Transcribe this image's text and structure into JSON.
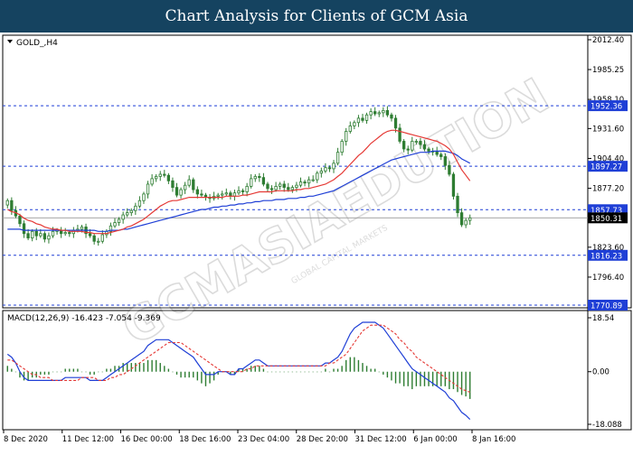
{
  "header": {
    "title": "Chart Analysis for Clients of GCM Asia"
  },
  "watermark": {
    "text": "GCMASIAEDUTION",
    "subtext": "GLOBAL CAPITAL MARKETS"
  },
  "colors": {
    "header_bg": "#154360",
    "candle": "#2e7d32",
    "ma_fast": "#e53935",
    "ma_slow": "#1f3fd6",
    "level_line": "#1f3fd6",
    "price_tag_bg": "#1f3fd6",
    "current_tag_bg": "#000000",
    "macd_hist": "#2e7d32",
    "macd_line": "#1f3fd6",
    "signal_line": "#e53935"
  },
  "chart_data": [
    {
      "type": "candlestick",
      "symbol_label": "GOLD_,H4",
      "ylim": [
        1770.89,
        2012.4
      ],
      "y_ticks": [
        "2012.40",
        "1985.25",
        "1958.10",
        "1931.60",
        "1904.40",
        "1877.20",
        "1850.75",
        "1823.60",
        "1796.40"
      ],
      "x_ticks": [
        "8 Dec 2020",
        "11 Dec 12:00",
        "16 Dec 00:00",
        "18 Dec 16:00",
        "23 Dec 04:00",
        "28 Dec 20:00",
        "31 Dec 12:00",
        "6 Jan 00:00",
        "8 Jan 16:00"
      ],
      "levels": [
        {
          "label": "1952.36",
          "value": 1952.36
        },
        {
          "label": "1897.27",
          "value": 1897.27
        },
        {
          "label": "1857.73",
          "value": 1857.73
        },
        {
          "label": "1816.23",
          "value": 1816.23
        },
        {
          "label": "1770.89",
          "value": 1770.89
        }
      ],
      "current_price": {
        "label": "1850.31",
        "value": 1850.31
      },
      "closes": [
        1866,
        1857,
        1852,
        1845,
        1836,
        1832,
        1838,
        1834,
        1836,
        1831,
        1834,
        1838,
        1839,
        1836,
        1837,
        1836,
        1839,
        1840,
        1842,
        1836,
        1834,
        1829,
        1829,
        1835,
        1838,
        1843,
        1846,
        1849,
        1853,
        1855,
        1857,
        1861,
        1866,
        1872,
        1881,
        1886,
        1888,
        1890,
        1889,
        1884,
        1878,
        1871,
        1876,
        1880,
        1885,
        1876,
        1872,
        1871,
        1869,
        1868,
        1870,
        1871,
        1872,
        1873,
        1870,
        1873,
        1875,
        1874,
        1879,
        1886,
        1888,
        1887,
        1881,
        1877,
        1876,
        1879,
        1881,
        1878,
        1876,
        1878,
        1880,
        1883,
        1882,
        1885,
        1885,
        1891,
        1893,
        1896,
        1895,
        1900,
        1910,
        1920,
        1929,
        1934,
        1937,
        1941,
        1939,
        1944,
        1947,
        1945,
        1946,
        1948,
        1944,
        1941,
        1932,
        1920,
        1913,
        1912,
        1920,
        1920,
        1917,
        1913,
        1911,
        1911,
        1908,
        1906,
        1898,
        1890,
        1870,
        1855,
        1844,
        1848,
        1850.31
      ],
      "ma_fast": {
        "period_label": "",
        "values": [
          1858,
          1856,
          1855,
          1853,
          1850,
          1848,
          1847,
          1845,
          1844,
          1842,
          1841,
          1840,
          1840,
          1839,
          1839,
          1838,
          1838,
          1838,
          1838,
          1837,
          1837,
          1836,
          1836,
          1836,
          1836,
          1837,
          1838,
          1839,
          1840,
          1842,
          1843,
          1845,
          1847,
          1849,
          1852,
          1855,
          1858,
          1861,
          1863,
          1865,
          1866,
          1866,
          1867,
          1868,
          1869,
          1869,
          1869,
          1869,
          1869,
          1869,
          1869,
          1869,
          1869,
          1870,
          1870,
          1870,
          1870,
          1871,
          1871,
          1872,
          1873,
          1874,
          1874,
          1874,
          1874,
          1875,
          1875,
          1875,
          1875,
          1875,
          1876,
          1876,
          1877,
          1877,
          1878,
          1879,
          1880,
          1881,
          1883,
          1885,
          1888,
          1891,
          1895,
          1899,
          1903,
          1907,
          1910,
          1914,
          1918,
          1921,
          1924,
          1927,
          1929,
          1930,
          1930,
          1929,
          1928,
          1927,
          1926,
          1925,
          1924,
          1923,
          1922,
          1921,
          1920,
          1918,
          1916,
          1913,
          1908,
          1901,
          1894,
          1889,
          1884
        ]
      },
      "ma_slow": {
        "period_label": "",
        "values": [
          1840,
          1840,
          1840,
          1840,
          1839,
          1839,
          1839,
          1839,
          1839,
          1839,
          1839,
          1839,
          1839,
          1839,
          1839,
          1839,
          1839,
          1839,
          1839,
          1839,
          1839,
          1839,
          1838,
          1838,
          1838,
          1839,
          1839,
          1839,
          1840,
          1840,
          1841,
          1842,
          1843,
          1844,
          1845,
          1846,
          1847,
          1848,
          1849,
          1850,
          1851,
          1852,
          1853,
          1854,
          1855,
          1856,
          1857,
          1858,
          1858,
          1859,
          1860,
          1860,
          1861,
          1861,
          1862,
          1862,
          1863,
          1863,
          1864,
          1864,
          1865,
          1865,
          1866,
          1866,
          1866,
          1867,
          1867,
          1867,
          1868,
          1868,
          1868,
          1869,
          1869,
          1870,
          1870,
          1871,
          1872,
          1873,
          1874,
          1875,
          1877,
          1879,
          1881,
          1883,
          1885,
          1887,
          1889,
          1891,
          1893,
          1895,
          1897,
          1899,
          1901,
          1903,
          1904,
          1905,
          1906,
          1907,
          1908,
          1909,
          1910,
          1910,
          1910,
          1911,
          1911,
          1911,
          1911,
          1910,
          1909,
          1907,
          1904,
          1902,
          1900
        ]
      }
    },
    {
      "type": "macd",
      "label": "MACD(12,26,9) -16.423 -7.054 -9.369",
      "params": "12,26,9",
      "values": {
        "macd": -16.423,
        "signal": -7.054,
        "histogram": -9.369
      },
      "ylim": [
        -18.088,
        18.54
      ],
      "y_ticks": [
        "18.54",
        "0.00",
        "-18.088"
      ],
      "macd_line": [
        6,
        5,
        3,
        0,
        -2,
        -3,
        -3,
        -3,
        -3,
        -3,
        -3,
        -3,
        -3,
        -3,
        -2,
        -2,
        -2,
        -2,
        -2,
        -2,
        -3,
        -3,
        -3,
        -3,
        -2,
        -1,
        0,
        1,
        2,
        3,
        4,
        5,
        6,
        7,
        9,
        10,
        11,
        11,
        11,
        11,
        10,
        9,
        8,
        7,
        6,
        5,
        3,
        1,
        -1,
        -1,
        -1,
        0,
        0,
        0,
        -1,
        -1,
        1,
        1,
        2,
        3,
        4,
        4,
        3,
        2,
        2,
        2,
        2,
        2,
        2,
        2,
        2,
        2,
        2,
        2,
        2,
        2,
        2,
        3,
        3,
        4,
        5,
        7,
        10,
        13,
        15,
        16,
        17,
        17,
        17,
        17,
        16,
        15,
        13,
        11,
        9,
        7,
        5,
        3,
        1,
        0,
        -1,
        -2,
        -3,
        -4,
        -5,
        -6,
        -7,
        -9,
        -10,
        -12,
        -14,
        -15,
        -16.423
      ],
      "signal_line": [
        4,
        4,
        3,
        2,
        1,
        0,
        -1,
        -1,
        -2,
        -2,
        -2,
        -3,
        -3,
        -3,
        -3,
        -3,
        -3,
        -3,
        -2,
        -2,
        -2,
        -2,
        -3,
        -3,
        -3,
        -2,
        -2,
        -1,
        -1,
        0,
        1,
        2,
        3,
        4,
        5,
        6,
        7,
        8,
        9,
        10,
        10,
        10,
        10,
        9,
        8,
        7,
        6,
        5,
        4,
        3,
        2,
        1,
        0,
        0,
        0,
        0,
        0,
        0,
        1,
        1,
        2,
        2,
        2,
        2,
        2,
        2,
        2,
        2,
        2,
        2,
        2,
        2,
        2,
        2,
        2,
        2,
        2,
        2,
        3,
        3,
        4,
        5,
        6,
        8,
        10,
        12,
        14,
        15,
        16,
        16,
        16,
        16,
        15,
        14,
        13,
        11,
        10,
        8,
        7,
        5,
        4,
        3,
        2,
        1,
        0,
        -1,
        -2,
        -3,
        -4,
        -5,
        -6,
        -6.5,
        -7.054
      ]
    }
  ]
}
